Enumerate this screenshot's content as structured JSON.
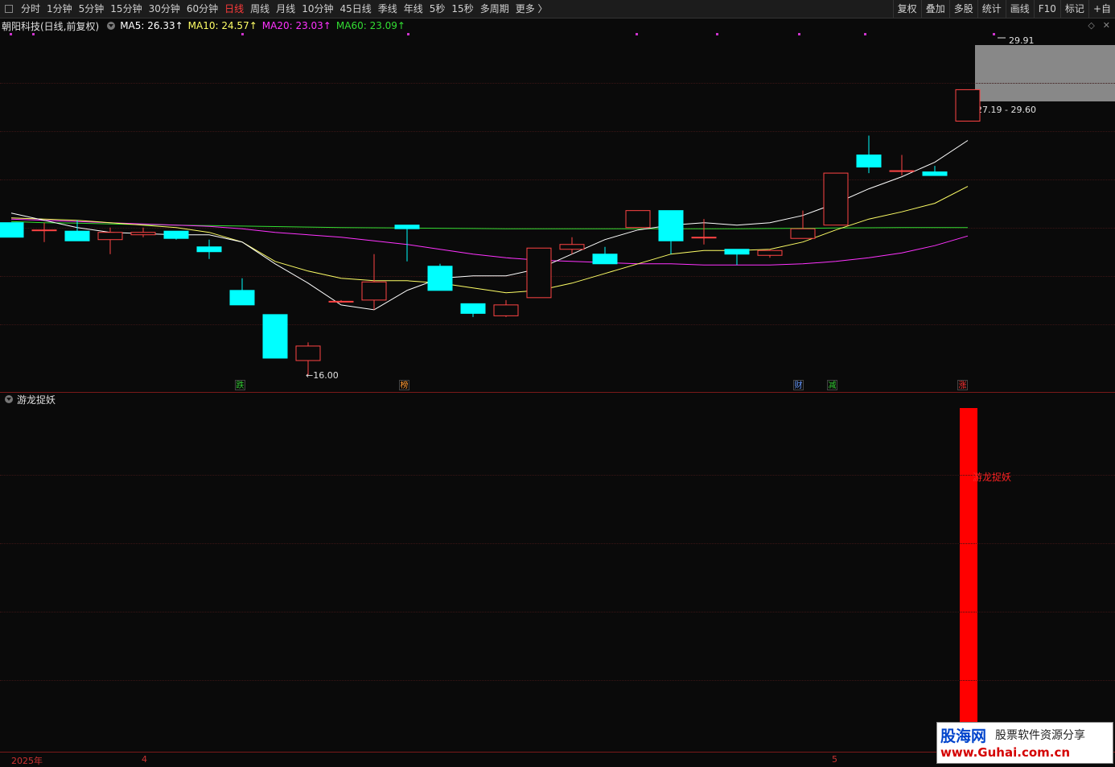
{
  "toolbar": {
    "tabs": [
      "分时",
      "1分钟",
      "5分钟",
      "15分钟",
      "30分钟",
      "60分钟",
      "日线",
      "周线",
      "月线",
      "10分钟",
      "45日线",
      "季线",
      "年线",
      "5秒",
      "15秒",
      "多周期",
      "更多 〉"
    ],
    "active_tab": "日线",
    "right_buttons": [
      "复权",
      "叠加",
      "多股",
      "统计",
      "画线",
      "F10",
      "标记",
      "+自"
    ]
  },
  "legend": {
    "title": "朝阳科技(日线,前复权)",
    "ma5": "MA5: 26.33↑",
    "ma10": "MA10: 24.57↑",
    "ma20": "MA20: 23.03↑",
    "ma60": "MA60: 23.09↑",
    "colors": {
      "ma5": "#ffffff",
      "ma10": "#ffff66",
      "ma20": "#ff33ff",
      "ma60": "#33dd33"
    }
  },
  "price_labels": {
    "high": "29.91",
    "low": "←16.00",
    "range": "27.19 - 29.60"
  },
  "event_tags": [
    {
      "text": "跌",
      "color": "#33cc33"
    },
    {
      "text": "榜",
      "color": "#ff9933"
    },
    {
      "text": "财",
      "color": "#6699ff"
    },
    {
      "text": "减",
      "color": "#33cc33"
    },
    {
      "text": "涨",
      "color": "#ff3333"
    }
  ],
  "indicator": {
    "name": "游龙捉妖",
    "bar_label": "游龙捉妖",
    "bar_color": "#ff0000"
  },
  "x_axis": {
    "labels": [
      "2025年",
      "4",
      "5"
    ]
  },
  "watermark": {
    "brand": "股海网",
    "slogan": "股票软件资源分享",
    "url": "www.Guhai.com.cn"
  },
  "chart_data": {
    "type": "candlestick",
    "candles": [
      {
        "o": 22.3,
        "c": 21.7,
        "h": 22.3,
        "l": 21.7
      },
      {
        "o": 22.0,
        "c": 22.0,
        "h": 22.3,
        "l": 21.5
      },
      {
        "o": 21.95,
        "c": 21.55,
        "h": 22.4,
        "l": 21.55
      },
      {
        "o": 21.6,
        "c": 21.9,
        "h": 22.1,
        "l": 21.0
      },
      {
        "o": 21.8,
        "c": 21.9,
        "h": 22.1,
        "l": 21.7
      },
      {
        "o": 21.95,
        "c": 21.65,
        "h": 21.95,
        "l": 21.6
      },
      {
        "o": 21.3,
        "c": 21.1,
        "h": 21.6,
        "l": 20.8
      },
      {
        "o": 19.5,
        "c": 18.9,
        "h": 20.0,
        "l": 18.9
      },
      {
        "o": 18.5,
        "c": 16.7,
        "h": 18.5,
        "l": 16.7
      },
      {
        "o": 16.6,
        "c": 17.2,
        "h": 17.35,
        "l": 16.0
      },
      {
        "o": 19.05,
        "c": 19.05,
        "h": 19.1,
        "l": 19.0
      },
      {
        "o": 19.1,
        "c": 19.85,
        "h": 21.0,
        "l": 18.7
      },
      {
        "o": 22.2,
        "c": 22.05,
        "h": 22.2,
        "l": 20.7
      },
      {
        "o": 20.5,
        "c": 19.5,
        "h": 20.6,
        "l": 19.5
      },
      {
        "o": 18.95,
        "c": 18.55,
        "h": 18.95,
        "l": 18.4
      },
      {
        "o": 18.45,
        "c": 18.9,
        "h": 19.1,
        "l": 18.4
      },
      {
        "o": 19.2,
        "c": 21.25,
        "h": 21.25,
        "l": 19.2
      },
      {
        "o": 21.2,
        "c": 21.4,
        "h": 21.7,
        "l": 21.0
      },
      {
        "o": 21.0,
        "c": 20.6,
        "h": 21.3,
        "l": 20.6
      },
      {
        "o": 22.1,
        "c": 22.8,
        "h": 22.8,
        "l": 22.1
      },
      {
        "o": 22.8,
        "c": 21.55,
        "h": 22.8,
        "l": 21.0
      },
      {
        "o": 21.7,
        "c": 21.7,
        "h": 22.45,
        "l": 21.4
      },
      {
        "o": 21.2,
        "c": 21.0,
        "h": 21.2,
        "l": 20.55
      },
      {
        "o": 20.95,
        "c": 21.15,
        "h": 21.2,
        "l": 20.85
      },
      {
        "o": 21.65,
        "c": 22.05,
        "h": 22.8,
        "l": 21.65
      },
      {
        "o": 22.2,
        "c": 24.35,
        "h": 24.35,
        "l": 22.2
      },
      {
        "o": 25.1,
        "c": 24.6,
        "h": 25.9,
        "l": 24.35
      },
      {
        "o": 24.45,
        "c": 24.45,
        "h": 25.1,
        "l": 24.25
      },
      {
        "o": 24.4,
        "c": 24.25,
        "h": 24.65,
        "l": 24.25
      },
      {
        "o": 26.5,
        "c": 27.8,
        "h": 27.8,
        "l": 26.5
      }
    ],
    "ma5": [
      22.7,
      22.4,
      22.1,
      21.9,
      21.85,
      21.8,
      21.8,
      21.5,
      20.6,
      19.8,
      18.9,
      18.7,
      19.5,
      20.0,
      20.1,
      20.1,
      20.4,
      21.0,
      21.6,
      22.0,
      22.2,
      22.3,
      22.2,
      22.3,
      22.6,
      23.1,
      23.7,
      24.2,
      24.8,
      25.7
    ],
    "ma10": [
      22.5,
      22.45,
      22.4,
      22.3,
      22.2,
      22.1,
      21.9,
      21.5,
      20.7,
      20.3,
      20.0,
      19.9,
      19.9,
      19.8,
      19.6,
      19.4,
      19.5,
      19.8,
      20.2,
      20.6,
      21.0,
      21.15,
      21.15,
      21.2,
      21.5,
      22.0,
      22.45,
      22.75,
      23.1,
      23.8
    ],
    "ma20": [
      22.45,
      22.4,
      22.35,
      22.3,
      22.25,
      22.2,
      22.15,
      22.05,
      21.9,
      21.8,
      21.7,
      21.55,
      21.4,
      21.2,
      21.0,
      20.85,
      20.75,
      20.7,
      20.65,
      20.6,
      20.6,
      20.55,
      20.55,
      20.55,
      20.6,
      20.7,
      20.85,
      21.05,
      21.35,
      21.75
    ],
    "ma60": [
      22.35,
      22.3,
      22.28,
      22.25,
      22.22,
      22.2,
      22.18,
      22.16,
      22.14,
      22.12,
      22.1,
      22.09,
      22.08,
      22.07,
      22.06,
      22.05,
      22.05,
      22.05,
      22.05,
      22.05,
      22.05,
      22.05,
      22.05,
      22.06,
      22.07,
      22.08,
      22.09,
      22.1,
      22.1,
      22.1
    ],
    "indicator_values": [
      0,
      0,
      0,
      0,
      0,
      0,
      0,
      0,
      0,
      0,
      0,
      0,
      0,
      0,
      0,
      0,
      0,
      0,
      0,
      0,
      0,
      0,
      0,
      0,
      0,
      0,
      0,
      0,
      0,
      1
    ],
    "ylim": [
      16.0,
      29.91
    ],
    "colors": {
      "up": "#ff4444",
      "down": "#00ffff"
    }
  }
}
